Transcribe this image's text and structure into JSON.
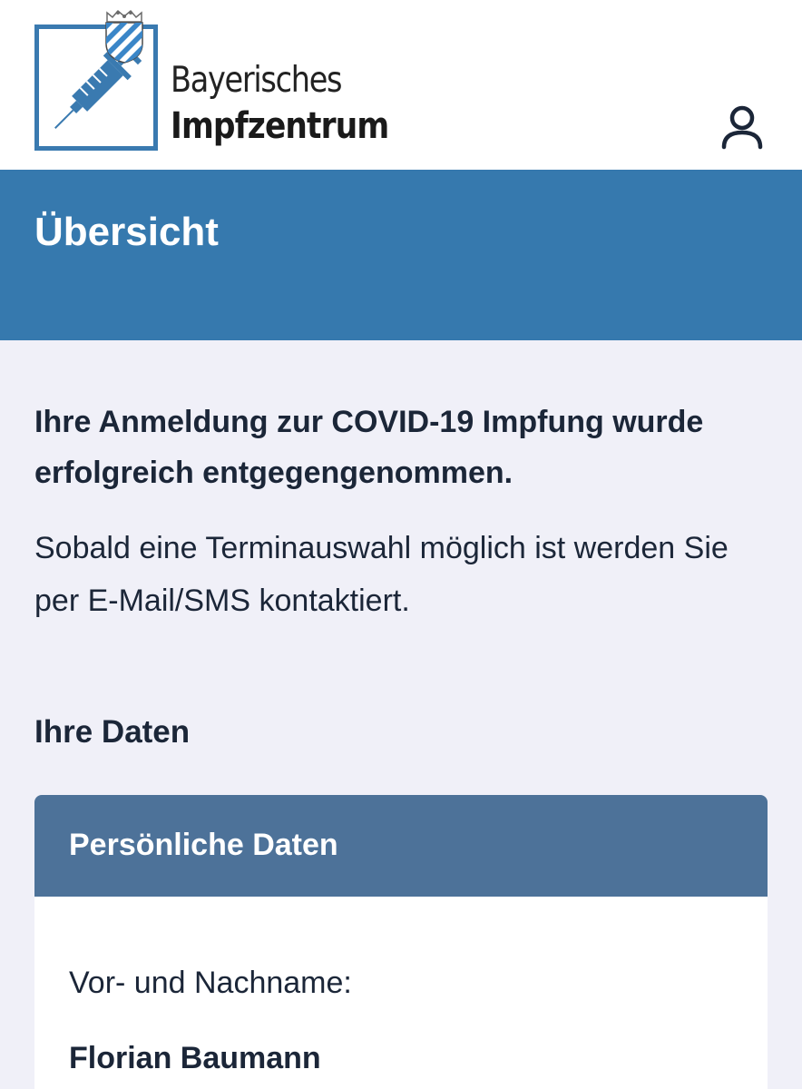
{
  "header": {
    "brand_line1": "Bayerisches",
    "brand_line2": "Impfzentrum",
    "logo_icon": "syringe-icon",
    "crest_icon": "bavarian-crest-icon",
    "user_icon": "user-icon"
  },
  "banner": {
    "title": "Übersicht"
  },
  "main": {
    "confirmation": "Ihre Anmeldung zur COVID-19 Impfung wurde erfolgreich entgegengenommen.",
    "info": "Sobald eine Terminauswahl möglich ist werden Sie per E-Mail/SMS kontaktiert.",
    "section_title": "Ihre Daten"
  },
  "card": {
    "title": "Persönliche Daten",
    "fields": [
      {
        "label": "Vor- und Nachname:",
        "value": "Florian Baumann"
      }
    ]
  },
  "colors": {
    "primary": "#3679ae",
    "card_header": "#4d7299",
    "logo_blue": "#3a7ab0",
    "background": "#f0f0f8",
    "text": "#1b2638"
  }
}
